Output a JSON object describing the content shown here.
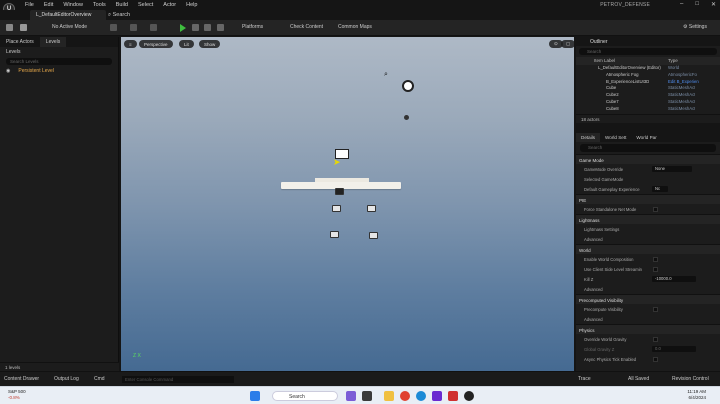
{
  "menubar": {
    "logo": "U",
    "menus": [
      "File",
      "Edit",
      "Window",
      "Tools",
      "Build",
      "Select",
      "Actor",
      "Help"
    ],
    "project": "PETROV_DEFENSE"
  },
  "tabs": {
    "level_tab": "L_DefaultEditorOverview",
    "search": "Search"
  },
  "toolbar": {
    "active_mode": "No Active Mode",
    "platforms": "Platforms",
    "check_content": "Check Content",
    "common_maps": "Common Maps",
    "settings": "Settings"
  },
  "left_panel": {
    "tabs": [
      "Place Actors",
      "Levels"
    ],
    "levels_dropdown": "Levels",
    "search_placeholder": "Search Levels",
    "persistent_level": "Persistent Level",
    "footer": "1 levels"
  },
  "viewport": {
    "perspective": "Perspective",
    "lit": "Lit",
    "show": "Show",
    "axis": "Z X"
  },
  "outliner": {
    "title": "Outliner",
    "search_placeholder": "Search",
    "col_label": "Item Label",
    "col_type": "Type",
    "rows": [
      {
        "label": "L_DefaultEditorOverview (Editor)",
        "type": "World"
      },
      {
        "label": "Atmospheric Fog",
        "type": "AtmosphericFo"
      },
      {
        "label": "B_ExperienceListUI3D",
        "type": "Edit B_Experien"
      },
      {
        "label": "Cube",
        "type": "StaticMeshAct"
      },
      {
        "label": "Cube2",
        "type": "StaticMeshAct"
      },
      {
        "label": "Cube7",
        "type": "StaticMeshAct"
      },
      {
        "label": "Cube8",
        "type": "StaticMeshAct"
      }
    ],
    "footer": "18 actors"
  },
  "details": {
    "tabs": [
      "Details",
      "World Sett",
      "World Par"
    ],
    "search_placeholder": "Search",
    "sections": [
      {
        "title": "Game Mode",
        "props": [
          {
            "label": "GameMode Override",
            "value": "None"
          },
          {
            "label": "Selected GameMode",
            "value": ""
          },
          {
            "label": "Default Gameplay Experience",
            "value": "Nc"
          }
        ]
      },
      {
        "title": "PIE",
        "props": [
          {
            "label": "Force Standalone Net Mode",
            "value": ""
          }
        ]
      },
      {
        "title": "Lightmass",
        "props": [
          {
            "label": "Lightmass Settings",
            "value": ""
          },
          {
            "label": "Advanced",
            "value": ""
          }
        ]
      },
      {
        "title": "World",
        "props": [
          {
            "label": "Enable World Composition",
            "value": ""
          },
          {
            "label": "Use Client Side Level Streamin",
            "value": ""
          },
          {
            "label": "Kill Z",
            "value": "-10000.0"
          },
          {
            "label": "Advanced",
            "value": ""
          }
        ]
      },
      {
        "title": "Precomputed Visibility",
        "props": [
          {
            "label": "Precompute Visibility",
            "value": ""
          },
          {
            "label": "Advanced",
            "value": ""
          }
        ]
      },
      {
        "title": "Physics",
        "props": [
          {
            "label": "Override World Gravity",
            "value": ""
          },
          {
            "label": "Global Gravity Z",
            "value": "0.0"
          },
          {
            "label": "Async Physics Tick Enabled",
            "value": ""
          }
        ]
      }
    ]
  },
  "statusbar": {
    "content_drawer": "Content Drawer",
    "output_log": "Output Log",
    "cmd": "Cmd",
    "cmd_placeholder": "Enter Console Command",
    "trace": "Trace",
    "all_saved": "All Saved",
    "revision_control": "Revision Control"
  },
  "taskbar": {
    "stock_name": "S&P 500",
    "stock_change": "-0.8%",
    "search": "Search",
    "time": "11:19 AM",
    "date": "6/4/2024"
  },
  "colors": {
    "accent": "#4f8ef0",
    "play": "#3fbf3f",
    "level": "#e6a84a"
  }
}
